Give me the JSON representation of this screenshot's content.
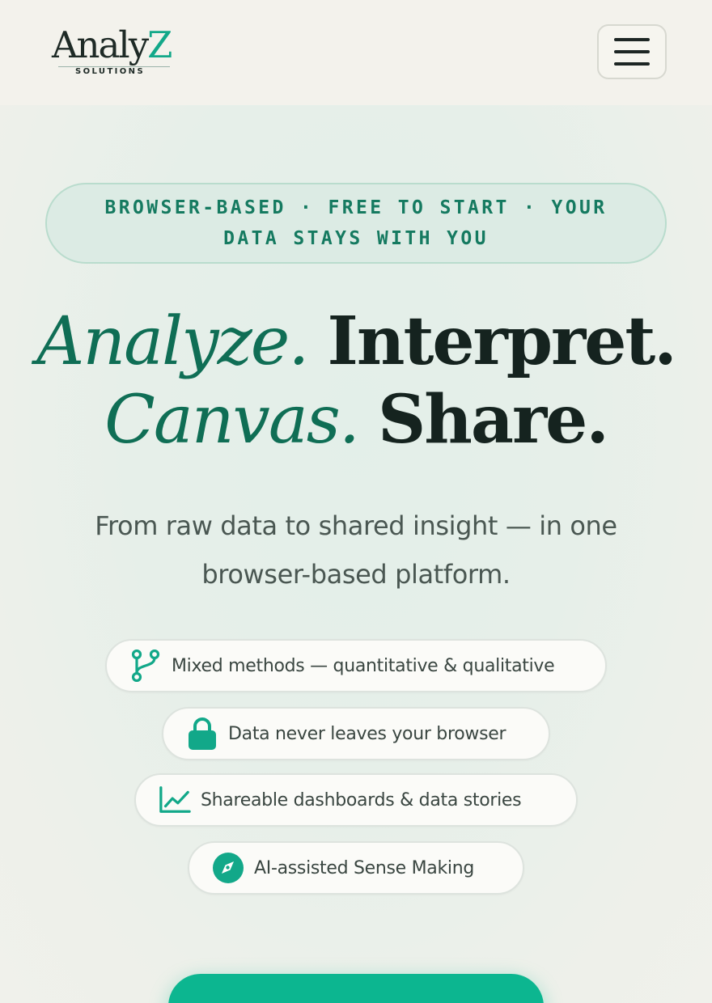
{
  "header": {
    "logo": {
      "word_main": "Analy",
      "word_accent": "Z",
      "sub": "SOLUTIONS"
    },
    "menu_icon": "hamburger-menu-icon"
  },
  "hero": {
    "tagline": "BROWSER-BASED · FREE TO START · YOUR DATA STAYS WITH YOU",
    "headline": {
      "line1_accent": "Analyze.",
      "line1_plain": "Interpret.",
      "line2_accent": "Canvas.",
      "line2_plain": "Share."
    },
    "subtitle": "From raw data to shared insight — in one browser-based platform.",
    "features": [
      {
        "icon": "branch-icon",
        "label": "Mixed methods — quantitative & qualitative"
      },
      {
        "icon": "lock-icon",
        "label": "Data never leaves your browser"
      },
      {
        "icon": "chart-line-icon",
        "label": "Shareable dashboards & data stories"
      },
      {
        "icon": "compass-icon",
        "label": "AI-assisted Sense Making"
      }
    ]
  },
  "colors": {
    "accent": "#12a889",
    "accent_dark": "#0f6e55",
    "cta": "#0cb690",
    "background": "#f1f0ea"
  }
}
